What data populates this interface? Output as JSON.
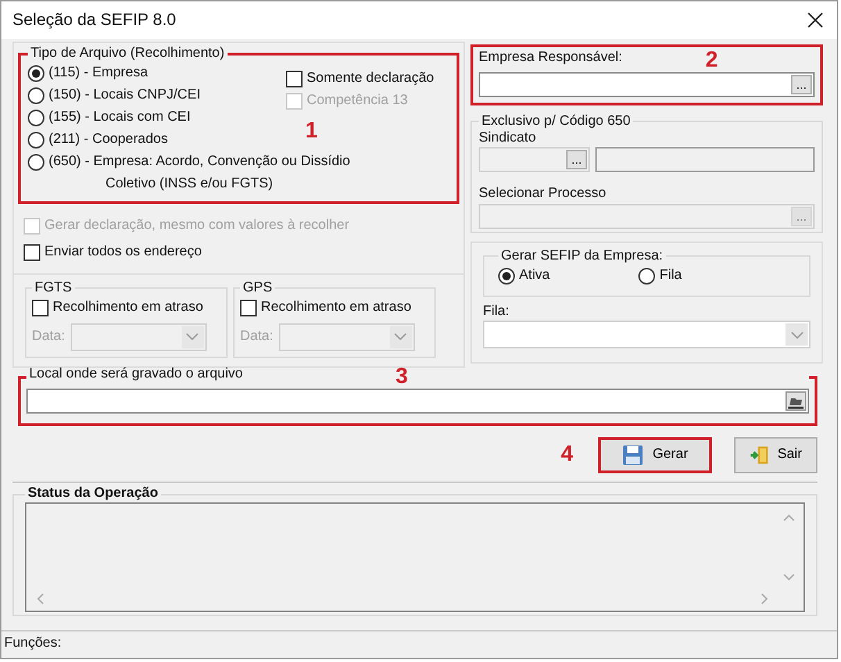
{
  "window": {
    "title": "Seleção da SEFIP 8.0"
  },
  "tipo_arquivo": {
    "legend": "Tipo de Arquivo (Recolhimento)",
    "annotation": "1",
    "options": [
      {
        "label": "(115) - Empresa",
        "selected": true
      },
      {
        "label": "(150) - Locais CNPJ/CEI",
        "selected": false
      },
      {
        "label": "(155) - Locais com CEI",
        "selected": false
      },
      {
        "label": "(211) - Cooperados",
        "selected": false
      },
      {
        "label": "(650) - Empresa: Acordo, Convenção ou Dissídio Coletivo (INSS e/ou FGTS)",
        "selected": false
      }
    ],
    "checks": [
      {
        "label": "Somente declaração",
        "checked": false,
        "disabled": false
      },
      {
        "label": "Competência 13",
        "checked": false,
        "disabled": true
      }
    ]
  },
  "options_extra": [
    {
      "label": "Gerar declaração, mesmo com valores à recolher",
      "checked": false,
      "disabled": true
    },
    {
      "label": "Enviar todos os endereço",
      "checked": false,
      "disabled": false
    }
  ],
  "arrears": [
    {
      "legend": "FGTS",
      "check_label": "Recolhimento em atraso",
      "checked": false,
      "date_label": "Data:"
    },
    {
      "legend": "GPS",
      "check_label": "Recolhimento em atraso",
      "checked": false,
      "date_label": "Data:"
    }
  ],
  "empresa_responsavel": {
    "label": "Empresa Responsável:",
    "annotation": "2",
    "button": "..."
  },
  "exclusivo_650": {
    "legend": "Exclusivo p/ Código 650",
    "sindicato_label": "Sindicato",
    "sindicato_button": "...",
    "processo_label": "Selecionar Processo",
    "processo_button": "..."
  },
  "gerar_sefip": {
    "legend": "Gerar SEFIP da Empresa:",
    "options": [
      {
        "label": "Ativa",
        "selected": true
      },
      {
        "label": "Fila",
        "selected": false
      }
    ]
  },
  "fila": {
    "label": "Fila:"
  },
  "local": {
    "legend": "Local onde será gravado o arquivo",
    "annotation": "3"
  },
  "buttons": [
    {
      "label": "Gerar",
      "kind": "save",
      "annotation": "4"
    },
    {
      "label": "Sair",
      "kind": "exit"
    }
  ],
  "status": {
    "legend": "Status da Operação"
  },
  "status_bar": {
    "label": "Funções:"
  }
}
